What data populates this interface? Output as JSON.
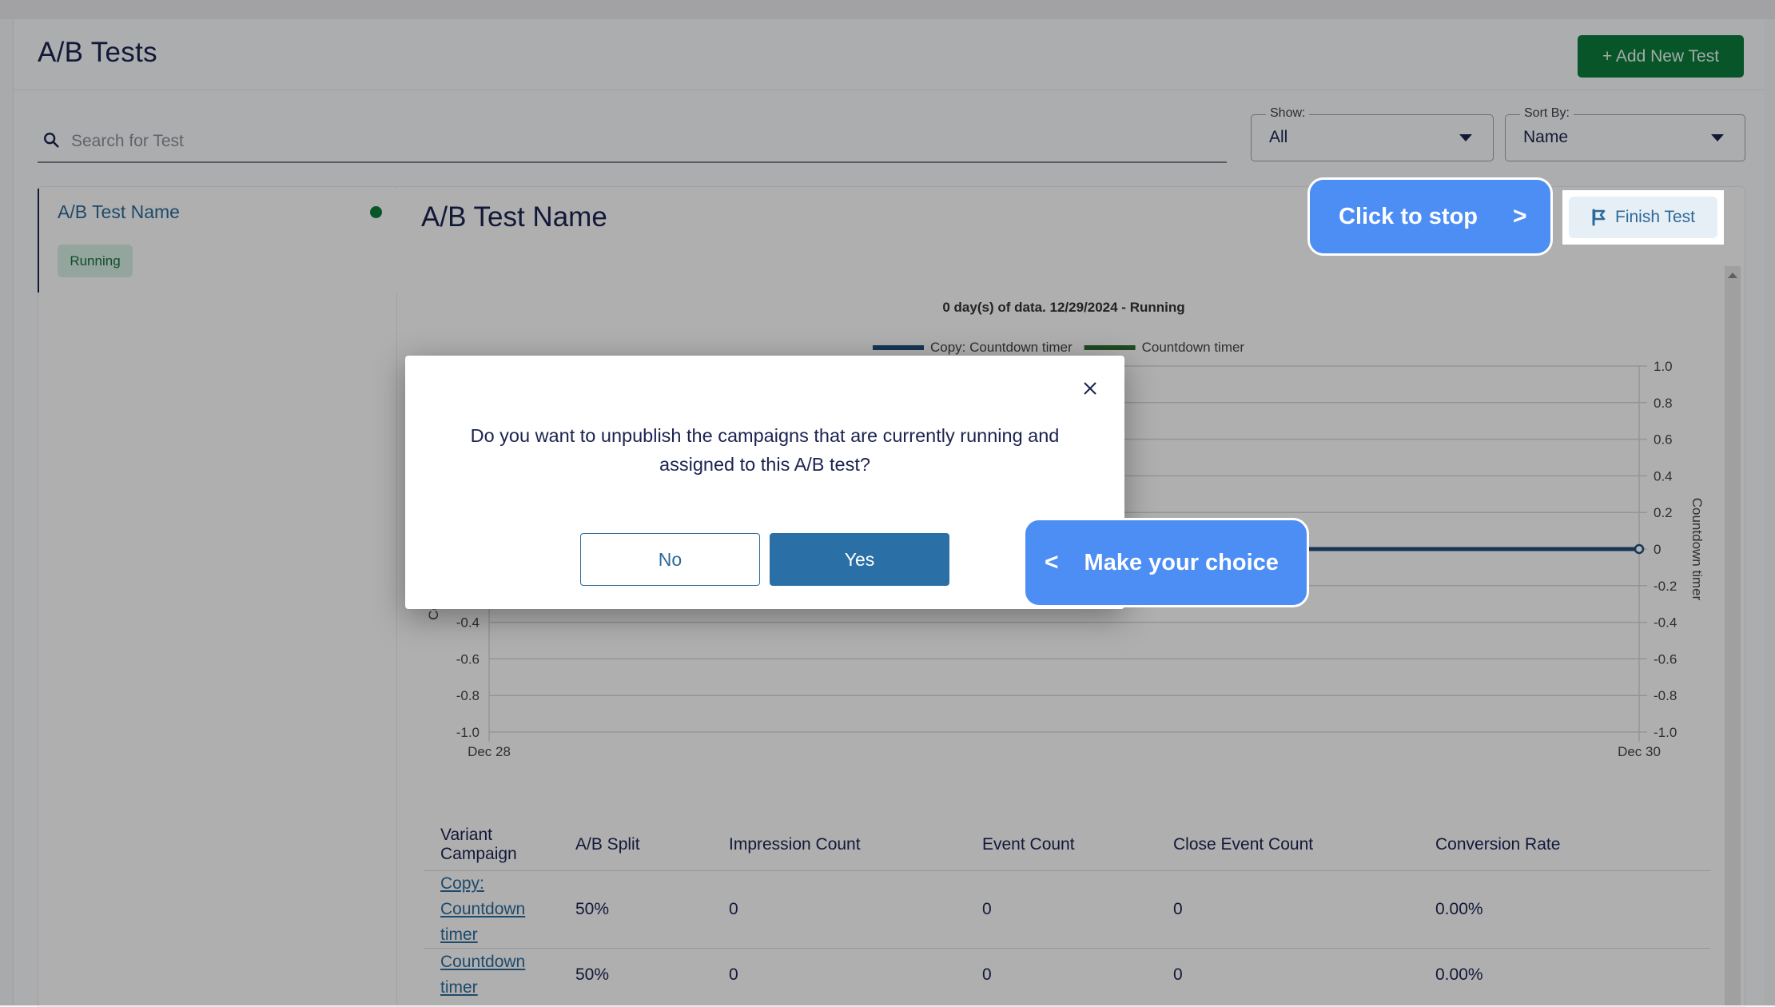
{
  "header": {
    "title": "A/B Tests",
    "add_button_label": "+ Add New Test"
  },
  "filters": {
    "search_placeholder": "Search for Test",
    "search_value": "",
    "show": {
      "label": "Show:",
      "value": "All"
    },
    "sort": {
      "label": "Sort By:",
      "value": "Name"
    }
  },
  "test_list": {
    "items": [
      {
        "name": "A/B Test Name",
        "status": "Running",
        "status_color": "#0b7a3b"
      }
    ]
  },
  "detail": {
    "title": "A/B Test Name",
    "finish_button_label": "Finish Test"
  },
  "chart_data": {
    "type": "line",
    "title": "0 day(s) of data. 12/29/2024 - Running",
    "legend": [
      {
        "name": "Copy: Countdown timer",
        "color": "#1f4e79"
      },
      {
        "name": "Countdown timer",
        "color": "#2e6b2e"
      }
    ],
    "legend_position": "top-center",
    "x_ticks": [
      "Dec 28",
      "Dec 30"
    ],
    "y_left_label": "Copy: Countdown timer",
    "y_right_label": "Countdown timer",
    "y_ticks_left": [
      "-1.0",
      "-0.8",
      "-0.6",
      "-0.4"
    ],
    "y_ticks_right": [
      "1.0",
      "0.8",
      "0.6",
      "0.4",
      "0.2",
      "0",
      "-0.2",
      "-0.4",
      "-0.6",
      "-0.8",
      "-1.0"
    ],
    "ylim": [
      -1.0,
      1.0
    ],
    "grid": true,
    "series": [
      {
        "name": "Copy: Countdown timer",
        "x": [
          "Dec 28",
          "Dec 30"
        ],
        "values": [
          0,
          0
        ]
      }
    ]
  },
  "table": {
    "columns": [
      "Variant Campaign",
      "A/B Split",
      "Impression Count",
      "Event Count",
      "Close Event Count",
      "Conversion Rate"
    ],
    "rows": [
      {
        "campaign": "Copy: Countdown timer",
        "split": "50%",
        "impressions": "0",
        "events": "0",
        "close_events": "0",
        "conversion": "0.00%"
      },
      {
        "campaign": "Countdown timer",
        "split": "50%",
        "impressions": "0",
        "events": "0",
        "close_events": "0",
        "conversion": "0.00%"
      }
    ]
  },
  "modal": {
    "message": "Do you want to unpublish the campaigns that are currently running and assigned to this A/B test?",
    "no_label": "No",
    "yes_label": "Yes"
  },
  "guide": {
    "stop_bubble": {
      "text": "Click to stop",
      "arrow": ">"
    },
    "choice_bubble": {
      "text": "Make your choice",
      "arrow": "<"
    }
  }
}
